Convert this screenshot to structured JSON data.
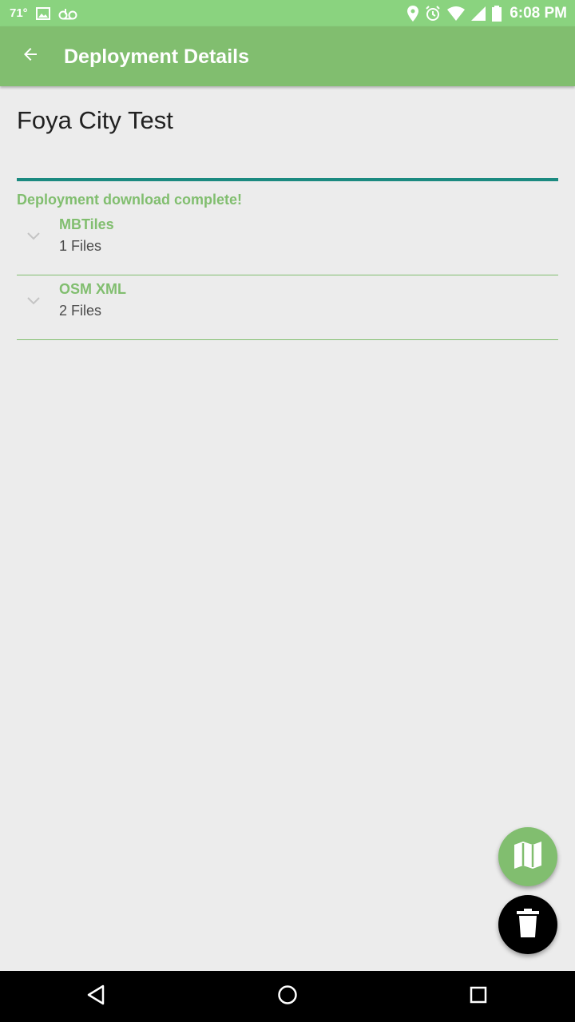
{
  "status_bar": {
    "temperature": "71°",
    "time": "6:08 PM",
    "icons": [
      "image-icon",
      "voicemail-icon",
      "location-icon",
      "alarm-icon",
      "wifi-icon",
      "signal-icon",
      "battery-icon"
    ]
  },
  "app_bar": {
    "title": "Deployment Details",
    "back_icon": "arrow-back-icon"
  },
  "deployment": {
    "name": "Foya City Test",
    "status_message": "Deployment download complete!",
    "groups": [
      {
        "name": "MBTiles",
        "count": "1 Files",
        "icon": "chevron-down-icon"
      },
      {
        "name": "OSM XML",
        "count": "2 Files",
        "icon": "chevron-down-icon"
      }
    ]
  },
  "fabs": {
    "map_icon": "map-icon",
    "delete_icon": "trash-icon"
  },
  "nav_bar": {
    "icons": [
      "back-triangle-icon",
      "home-circle-icon",
      "recents-square-icon"
    ]
  },
  "colors": {
    "status_bar": "#8ad37f",
    "app_bar": "#81be6f",
    "accent_green": "#81be6f",
    "progress_teal": "#1b8a80",
    "background": "#ececec"
  }
}
